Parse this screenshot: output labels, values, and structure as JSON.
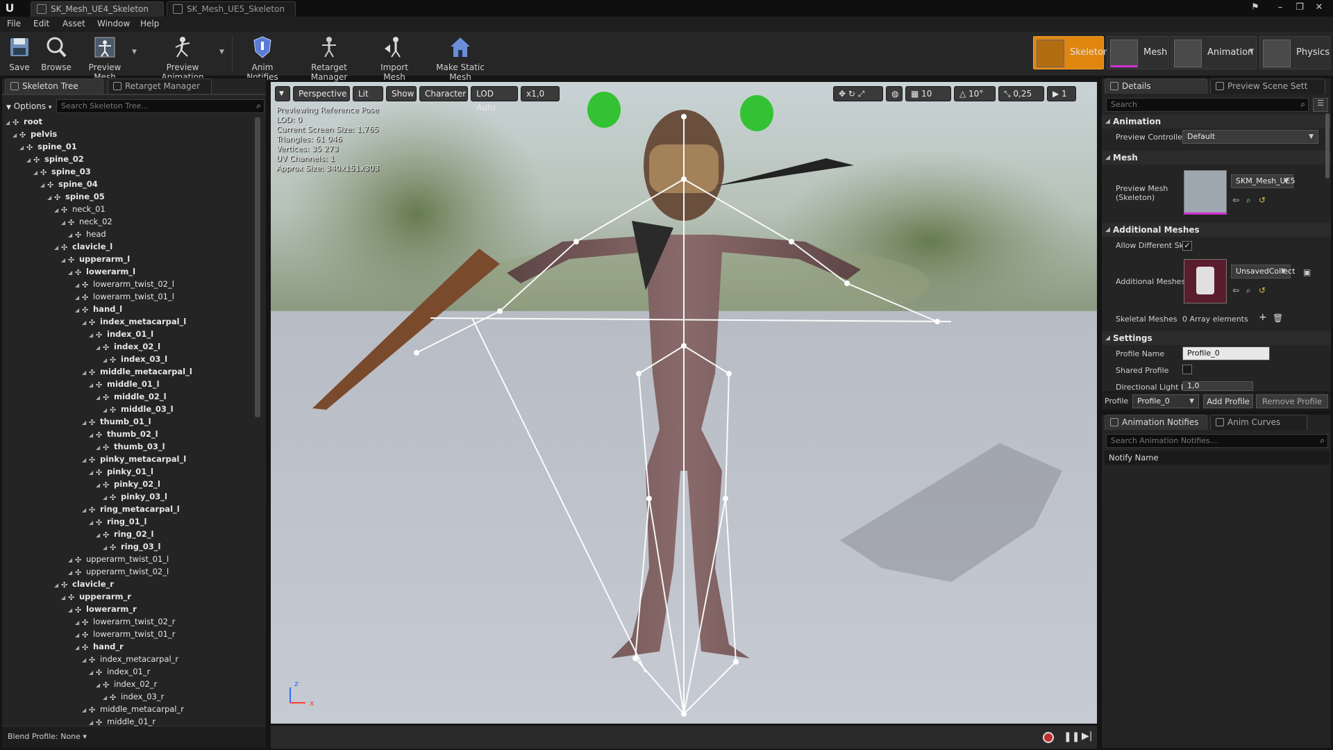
{
  "titlebar": {
    "tabs": [
      {
        "label": "SK_Mesh_UE4_Skeleton",
        "close": "×"
      },
      {
        "label": "SK_Mesh_UE5_Skeleton",
        "close": "×"
      }
    ]
  },
  "menu": {
    "items": [
      "File",
      "Edit",
      "Asset",
      "Window",
      "Help"
    ]
  },
  "toolbar": {
    "buttons": [
      "Save",
      "Browse",
      "Preview Mesh",
      "Preview Animation",
      "Anim Notifies",
      "Retarget Manager",
      "Import Mesh",
      "Make Static Mesh"
    ],
    "modes": [
      "Skeleton",
      "Mesh",
      "Animation",
      "Physics"
    ]
  },
  "left_panel": {
    "tabs": [
      "Skeleton Tree",
      "Retarget Manager"
    ],
    "options_label": "Options",
    "search_placeholder": "Search Skeleton Tree...",
    "blend_profile": "Blend Profile: None",
    "bones": [
      {
        "name": "root",
        "depth": 0,
        "bold": true
      },
      {
        "name": "pelvis",
        "depth": 1,
        "bold": true
      },
      {
        "name": "spine_01",
        "depth": 2,
        "bold": true
      },
      {
        "name": "spine_02",
        "depth": 3,
        "bold": true
      },
      {
        "name": "spine_03",
        "depth": 4,
        "bold": true
      },
      {
        "name": "spine_04",
        "depth": 5,
        "bold": true
      },
      {
        "name": "spine_05",
        "depth": 6,
        "bold": true
      },
      {
        "name": "neck_01",
        "depth": 7,
        "bold": false
      },
      {
        "name": "neck_02",
        "depth": 8,
        "bold": false
      },
      {
        "name": "head",
        "depth": 9,
        "bold": false
      },
      {
        "name": "clavicle_l",
        "depth": 7,
        "bold": true
      },
      {
        "name": "upperarm_l",
        "depth": 8,
        "bold": true
      },
      {
        "name": "lowerarm_l",
        "depth": 9,
        "bold": true
      },
      {
        "name": "lowerarm_twist_02_l",
        "depth": 10,
        "bold": false
      },
      {
        "name": "lowerarm_twist_01_l",
        "depth": 10,
        "bold": false
      },
      {
        "name": "hand_l",
        "depth": 10,
        "bold": true
      },
      {
        "name": "index_metacarpal_l",
        "depth": 11,
        "bold": true
      },
      {
        "name": "index_01_l",
        "depth": 12,
        "bold": true
      },
      {
        "name": "index_02_l",
        "depth": 13,
        "bold": true
      },
      {
        "name": "index_03_l",
        "depth": 14,
        "bold": true
      },
      {
        "name": "middle_metacarpal_l",
        "depth": 11,
        "bold": true
      },
      {
        "name": "middle_01_l",
        "depth": 12,
        "bold": true
      },
      {
        "name": "middle_02_l",
        "depth": 13,
        "bold": true
      },
      {
        "name": "middle_03_l",
        "depth": 14,
        "bold": true
      },
      {
        "name": "thumb_01_l",
        "depth": 11,
        "bold": true
      },
      {
        "name": "thumb_02_l",
        "depth": 12,
        "bold": true
      },
      {
        "name": "thumb_03_l",
        "depth": 13,
        "bold": true
      },
      {
        "name": "pinky_metacarpal_l",
        "depth": 11,
        "bold": true
      },
      {
        "name": "pinky_01_l",
        "depth": 12,
        "bold": true
      },
      {
        "name": "pinky_02_l",
        "depth": 13,
        "bold": true
      },
      {
        "name": "pinky_03_l",
        "depth": 14,
        "bold": true
      },
      {
        "name": "ring_metacarpal_l",
        "depth": 11,
        "bold": true
      },
      {
        "name": "ring_01_l",
        "depth": 12,
        "bold": true
      },
      {
        "name": "ring_02_l",
        "depth": 13,
        "bold": true
      },
      {
        "name": "ring_03_l",
        "depth": 14,
        "bold": true
      },
      {
        "name": "upperarm_twist_01_l",
        "depth": 9,
        "bold": false
      },
      {
        "name": "upperarm_twist_02_l",
        "depth": 9,
        "bold": false
      },
      {
        "name": "clavicle_r",
        "depth": 7,
        "bold": true
      },
      {
        "name": "upperarm_r",
        "depth": 8,
        "bold": true
      },
      {
        "name": "lowerarm_r",
        "depth": 9,
        "bold": true
      },
      {
        "name": "lowerarm_twist_02_r",
        "depth": 10,
        "bold": false
      },
      {
        "name": "lowerarm_twist_01_r",
        "depth": 10,
        "bold": false
      },
      {
        "name": "hand_r",
        "depth": 10,
        "bold": true
      },
      {
        "name": "index_metacarpal_r",
        "depth": 11,
        "bold": false
      },
      {
        "name": "index_01_r",
        "depth": 12,
        "bold": false
      },
      {
        "name": "index_02_r",
        "depth": 13,
        "bold": false
      },
      {
        "name": "index_03_r",
        "depth": 14,
        "bold": false
      },
      {
        "name": "middle_metacarpal_r",
        "depth": 11,
        "bold": false
      },
      {
        "name": "middle_01_r",
        "depth": 12,
        "bold": false
      }
    ]
  },
  "viewport": {
    "buttons": [
      "Perspective",
      "Lit",
      "Show",
      "Character",
      "LOD Auto",
      "x1,0"
    ],
    "right_controls": {
      "grid": "10",
      "angle": "10°",
      "scale": "0,25",
      "cam": "1"
    },
    "info": [
      "Previewing Reference Pose",
      "LOD: 0",
      "Current Screen Size: 1,765",
      "Triangles: 61 046",
      "Vertices: 35 273",
      "UV Channels: 1",
      "Approx Size: 340x151x303"
    ],
    "axis_z": "z",
    "axis_x": "x"
  },
  "details": {
    "tabs": [
      "Details",
      "Preview Scene Sett"
    ],
    "search_placeholder": "Search",
    "animation": {
      "title": "Animation",
      "preview_controller_label": "Preview Controller",
      "preview_controller_value": "Default"
    },
    "mesh": {
      "title": "Mesh",
      "preview_mesh_label": "Preview Mesh (Skeleton)",
      "preview_mesh_value": "SKM_Mesh_UE5"
    },
    "additional": {
      "title": "Additional Meshes",
      "allow_label": "Allow Different Sk",
      "allow_checked": true,
      "meshes_label": "Additional Meshes",
      "meshes_value": "UnsavedCollect",
      "skeletal_label": "Skeletal Meshes",
      "skeletal_value": "0 Array elements"
    },
    "settings": {
      "title": "Settings",
      "profile_name_label": "Profile Name",
      "profile_name_value": "Profile_0",
      "shared_label": "Shared Profile",
      "shared_checked": false,
      "directional_label": "Directional Light Ir",
      "directional_value": "1,0"
    },
    "profile_bar": {
      "label": "Profile",
      "value": "Profile_0",
      "add": "Add Profile",
      "remove": "Remove Profile"
    }
  },
  "notifies": {
    "tabs": [
      "Animation Notifies",
      "Anim Curves"
    ],
    "search_placeholder": "Search Animation Notifies...",
    "column": "Notify Name"
  },
  "colors": {
    "accent": "#e0860f",
    "bone_line": "#ffffff",
    "axis_z": "#2d6bff",
    "axis_x": "#ff3b30"
  }
}
